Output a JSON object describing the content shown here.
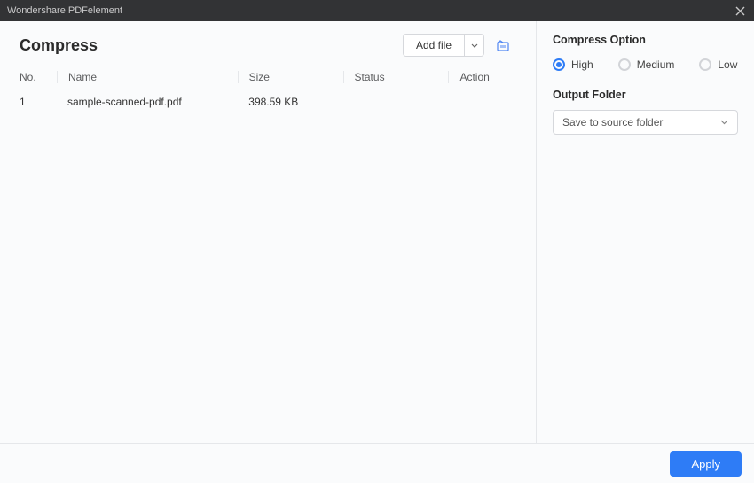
{
  "titlebar": {
    "app_name": "Wondershare PDFelement"
  },
  "page": {
    "title": "Compress"
  },
  "toolbar": {
    "add_file_label": "Add file"
  },
  "table": {
    "headers": {
      "no": "No.",
      "name": "Name",
      "size": "Size",
      "status": "Status",
      "action": "Action"
    },
    "rows": [
      {
        "no": "1",
        "name": "sample-scanned-pdf.pdf",
        "size": "398.59 KB",
        "status": "",
        "action": ""
      }
    ]
  },
  "side": {
    "compress_option_title": "Compress Option",
    "options": {
      "high": "High",
      "medium": "Medium",
      "low": "Low"
    },
    "selected_option": "high",
    "output_folder_title": "Output Folder",
    "output_folder_value": "Save to source folder"
  },
  "footer": {
    "apply_label": "Apply"
  }
}
